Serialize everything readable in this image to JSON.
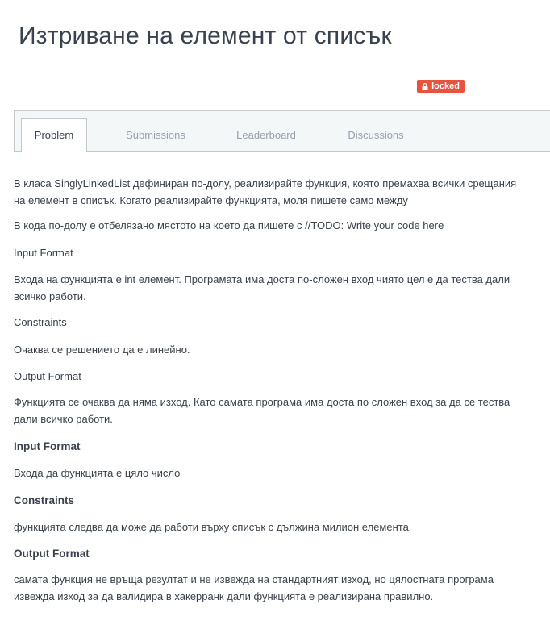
{
  "header": {
    "title": "Изтриване на елемент от списък",
    "badge_label": "locked",
    "badge_icon": "lock-icon",
    "badge_color": "#e8533f"
  },
  "tabs": [
    {
      "label": "Problem",
      "active": true
    },
    {
      "label": "Submissions",
      "active": false
    },
    {
      "label": "Leaderboard",
      "active": false
    },
    {
      "label": "Discussions",
      "active": false
    }
  ],
  "problem": {
    "intro_1": "В класа SinglyLinkedList дефиниран по-долу, реализирайте функция, която премахва всички срещания на елемент в списък. Когато реализирайте функцията, моля пишете само между",
    "intro_2": "В кода по-долу е отбелязано мястото на което да пишете с //TODO: Write your code here",
    "input_format_label": "Input Format",
    "input_format_text": "Входа на функцията е int елемент. Програмата има доста по-сложен вход чиято цел е да тества дали всичко работи.",
    "constraints_label": "Constraints",
    "constraints_text": "Очаква се решението да е линейно.",
    "output_format_label": "Output Format",
    "output_format_text": "Функцията се очаква да няма изход. Като самата програма има доста по сложен вход за да се тества дали всичко работи.",
    "input_format_heading": "Input Format",
    "input_format_body": "Входа да функцията е цяло число",
    "constraints_heading": "Constraints",
    "constraints_body": "функцията следва да може да работи върху списък с дължина милион елемента.",
    "output_format_heading": "Output Format",
    "output_format_body": "самата функция не връща резултат и не извежда на стандартният изход, но цялостната програма извежда изход за да валидира в хакерранк дали функцията е реализирана правилно."
  }
}
